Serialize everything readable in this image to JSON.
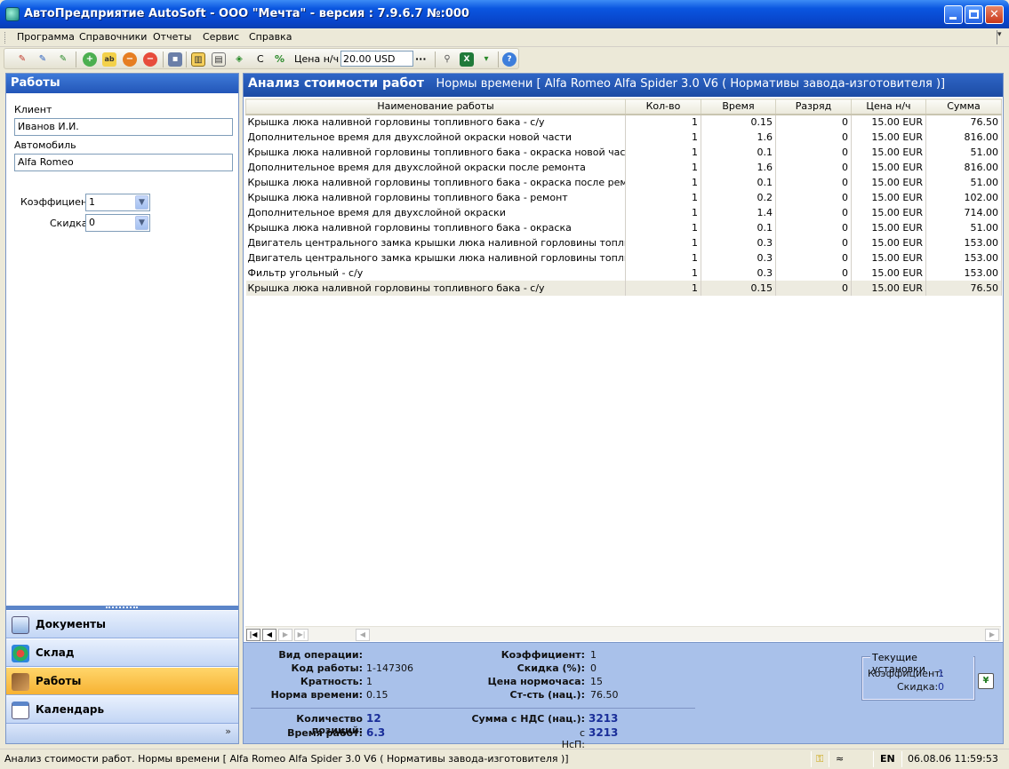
{
  "window": {
    "title": "АвтоПредприятие AutoSoft  - ООО \"Мечта\" - версия : 7.9.6.7  №:000"
  },
  "menu": [
    "Программа",
    "Справочники",
    "Отчеты",
    "Сервис",
    "Справка"
  ],
  "toolbar": {
    "rate_label": "Цена н/ч",
    "rate_value": "20.00 USD",
    "c_label": "С",
    "percent_label": "%",
    "more_label": "···"
  },
  "left": {
    "title": "Работы",
    "client_label": "Клиент",
    "client_value": "Иванов И.И.",
    "car_label": "Автомобиль",
    "car_value": "Alfa Romeo",
    "coef_label": "Коэффициент",
    "coef_value": "1",
    "discount_label": "Скидка",
    "discount_value": "0",
    "nav": [
      {
        "label": "Документы"
      },
      {
        "label": "Склад"
      },
      {
        "label": "Работы"
      },
      {
        "label": "Календарь"
      }
    ],
    "more": "»"
  },
  "right": {
    "title": "Анализ стоимости работ",
    "subtitle": "Нормы времени [ Alfa Romeo Alfa Spider 3.0 V6 ( Нормативы завода-изготовителя )]",
    "columns": [
      "Наименование работы",
      "Кол-во",
      "Время",
      "Разряд",
      "Цена н/ч",
      "Сумма"
    ],
    "rows": [
      [
        "Крышка люка наливной горловины топливного бака - с/у",
        "1",
        "0.15",
        "0",
        "15.00 EUR",
        "76.50"
      ],
      [
        "Дополнительное время для двухслойной окраски новой части",
        "1",
        "1.6",
        "0",
        "15.00 EUR",
        "816.00"
      ],
      [
        "Крышка люка наливной горловины топливного бака - окраска новой части",
        "1",
        "0.1",
        "0",
        "15.00 EUR",
        "51.00"
      ],
      [
        "Дополнительное время для двухслойной окраски после ремонта",
        "1",
        "1.6",
        "0",
        "15.00 EUR",
        "816.00"
      ],
      [
        "Крышка люка наливной горловины топливного бака - окраска после ремонта",
        "1",
        "0.1",
        "0",
        "15.00 EUR",
        "51.00"
      ],
      [
        "Крышка люка наливной горловины топливного бака - ремонт",
        "1",
        "0.2",
        "0",
        "15.00 EUR",
        "102.00"
      ],
      [
        "Дополнительное время для двухслойной окраски",
        "1",
        "1.4",
        "0",
        "15.00 EUR",
        "714.00"
      ],
      [
        "Крышка люка наливной горловины топливного бака - окраска",
        "1",
        "0.1",
        "0",
        "15.00 EUR",
        "51.00"
      ],
      [
        "Двигатель центрального замка крышки люка наливной горловины топливного бака",
        "1",
        "0.3",
        "0",
        "15.00 EUR",
        "153.00"
      ],
      [
        "Двигатель центрального замка крышки люка наливной горловины топливного бака",
        "1",
        "0.3",
        "0",
        "15.00 EUR",
        "153.00"
      ],
      [
        "Фильтр угольный - с/у",
        "1",
        "0.3",
        "0",
        "15.00 EUR",
        "153.00"
      ],
      [
        "Крышка люка наливной горловины топливного бака - с/у",
        "1",
        "0.15",
        "0",
        "15.00 EUR",
        "76.50"
      ]
    ],
    "selected_row": 11
  },
  "info": {
    "op_type_label": "Вид операции:",
    "code_label": "Код работы:",
    "code_value": "1-147306",
    "mult_label": "Кратность:",
    "mult_value": "1",
    "norm_label": "Норма времени:",
    "norm_value": "0.15",
    "coef_label": "Коэффициент:",
    "coef_value": "1",
    "disc_label": "Скидка (%):",
    "disc_value": "0",
    "hour_label": "Цена нормочаса:",
    "hour_value": "15",
    "cost_label": "Ст-сть (нац.):",
    "cost_value": "76.50",
    "count_label": "Количество позиций:",
    "count_value": "12",
    "time_label": "Время работ:",
    "time_value": "6.3",
    "vat_label": "Сумма с НДС (нац.):",
    "vat_value": "3213",
    "nsp_label": "с НсП:",
    "nsp_value": "3213",
    "settings_title": "Текущие установки",
    "settings_coef_label": "Коэффициент:",
    "settings_coef_value": "1",
    "settings_disc_label": "Скидка:",
    "settings_disc_value": "0"
  },
  "status": {
    "text": "Анализ стоимости работ. Нормы времени [ Alfa Romeo Alfa Spider 3.0 V6 ( Нормативы завода-изготовителя )]",
    "lang": "EN",
    "datetime": "06.08.06  11:59:53"
  }
}
